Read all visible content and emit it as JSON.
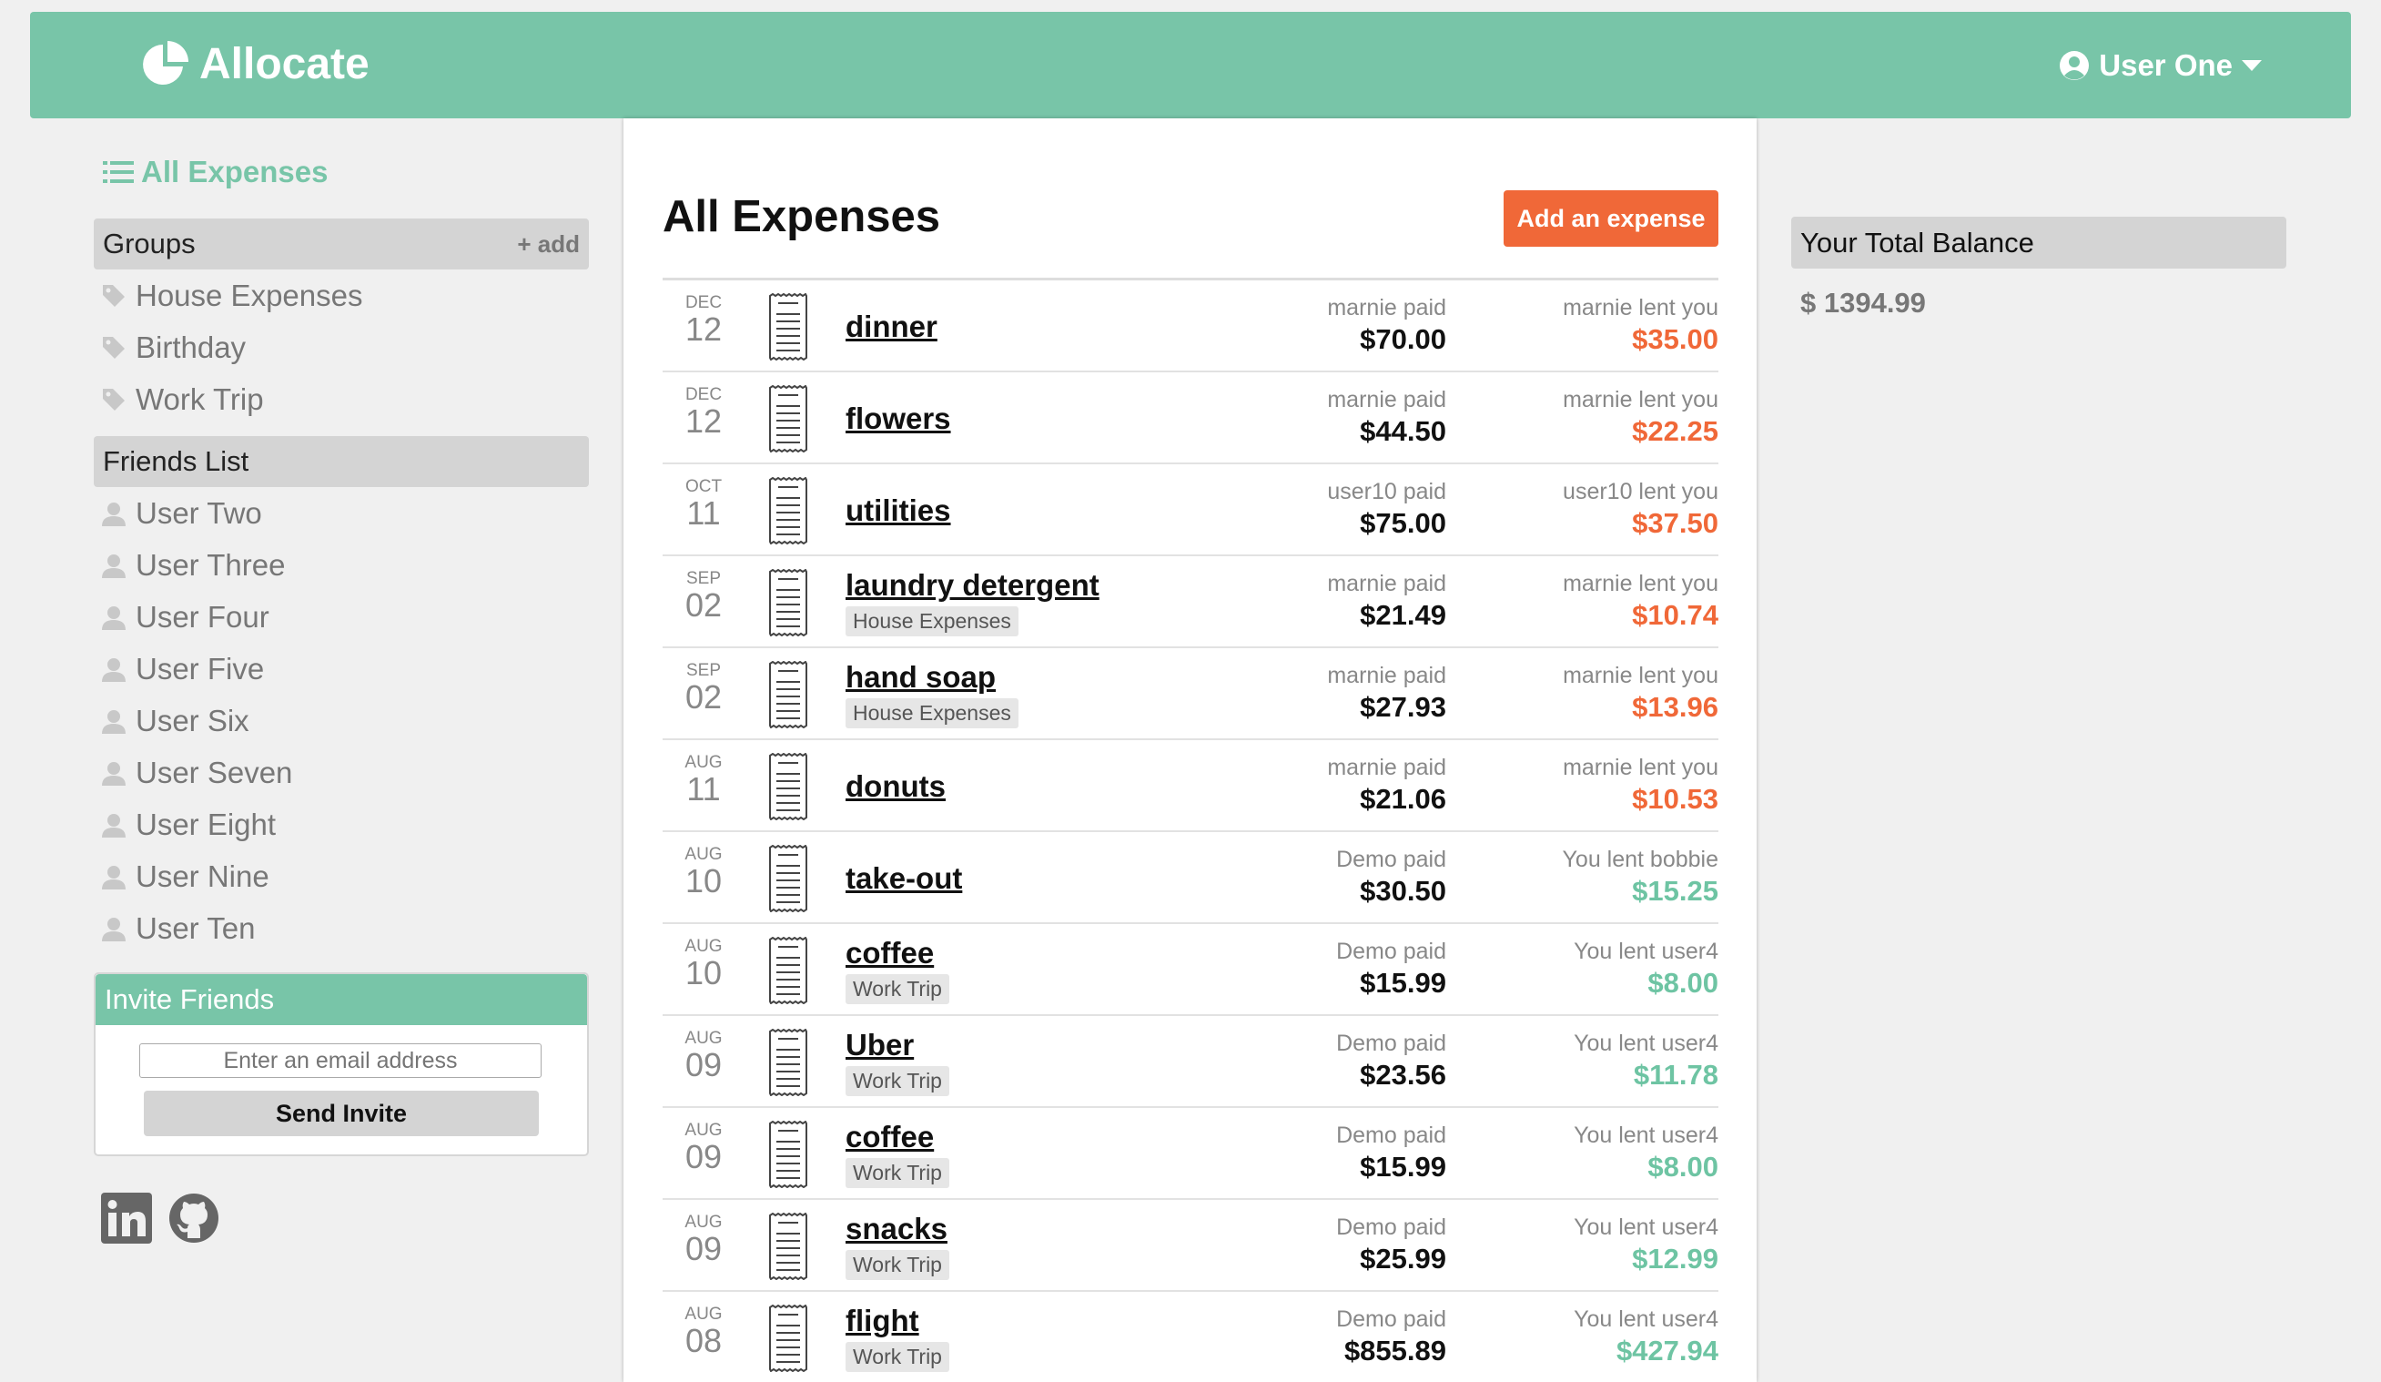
{
  "header": {
    "brand": "Allocate",
    "user": "User One"
  },
  "sidebar": {
    "all_expenses": "All Expenses",
    "groups_title": "Groups",
    "groups_add": "+ add",
    "groups": [
      {
        "label": "House Expenses"
      },
      {
        "label": "Birthday"
      },
      {
        "label": "Work Trip"
      }
    ],
    "friends_title": "Friends List",
    "friends": [
      {
        "label": "User Two"
      },
      {
        "label": "User Three"
      },
      {
        "label": "User Four"
      },
      {
        "label": "User Five"
      },
      {
        "label": "User Six"
      },
      {
        "label": "User Seven"
      },
      {
        "label": "User Eight"
      },
      {
        "label": "User Nine"
      },
      {
        "label": "User Ten"
      }
    ],
    "invite_title": "Invite Friends",
    "invite_placeholder": "Enter an email address",
    "invite_button": "Send Invite",
    "social_icons": [
      "linkedin-icon",
      "github-icon"
    ]
  },
  "main": {
    "title": "All Expenses",
    "add_button": "Add an expense",
    "rows": [
      {
        "mon": "DEC",
        "day": "12",
        "name": "dinner",
        "tag": "",
        "paid_by": "marnie paid",
        "paid": "$70.00",
        "lent_text": "marnie lent you",
        "lent": "$35.00",
        "color": "orange"
      },
      {
        "mon": "DEC",
        "day": "12",
        "name": "flowers",
        "tag": "",
        "paid_by": "marnie paid",
        "paid": "$44.50",
        "lent_text": "marnie lent you",
        "lent": "$22.25",
        "color": "orange"
      },
      {
        "mon": "OCT",
        "day": "11",
        "name": "utilities",
        "tag": "",
        "paid_by": "user10 paid",
        "paid": "$75.00",
        "lent_text": "user10 lent you",
        "lent": "$37.50",
        "color": "orange"
      },
      {
        "mon": "SEP",
        "day": "02",
        "name": "laundry detergent",
        "tag": "House Expenses",
        "paid_by": "marnie paid",
        "paid": "$21.49",
        "lent_text": "marnie lent you",
        "lent": "$10.74",
        "color": "orange"
      },
      {
        "mon": "SEP",
        "day": "02",
        "name": "hand soap",
        "tag": "House Expenses",
        "paid_by": "marnie paid",
        "paid": "$27.93",
        "lent_text": "marnie lent you",
        "lent": "$13.96",
        "color": "orange"
      },
      {
        "mon": "AUG",
        "day": "11",
        "name": "donuts",
        "tag": "",
        "paid_by": "marnie paid",
        "paid": "$21.06",
        "lent_text": "marnie lent you",
        "lent": "$10.53",
        "color": "orange"
      },
      {
        "mon": "AUG",
        "day": "10",
        "name": "take-out",
        "tag": "",
        "paid_by": "Demo paid",
        "paid": "$30.50",
        "lent_text": "You lent bobbie",
        "lent": "$15.25",
        "color": "green"
      },
      {
        "mon": "AUG",
        "day": "10",
        "name": "coffee",
        "tag": "Work Trip",
        "paid_by": "Demo paid",
        "paid": "$15.99",
        "lent_text": "You lent user4",
        "lent": "$8.00",
        "color": "green"
      },
      {
        "mon": "AUG",
        "day": "09",
        "name": "Uber",
        "tag": "Work Trip",
        "paid_by": "Demo paid",
        "paid": "$23.56",
        "lent_text": "You lent user4",
        "lent": "$11.78",
        "color": "green"
      },
      {
        "mon": "AUG",
        "day": "09",
        "name": "coffee",
        "tag": "Work Trip",
        "paid_by": "Demo paid",
        "paid": "$15.99",
        "lent_text": "You lent user4",
        "lent": "$8.00",
        "color": "green"
      },
      {
        "mon": "AUG",
        "day": "09",
        "name": "snacks",
        "tag": "Work Trip",
        "paid_by": "Demo paid",
        "paid": "$25.99",
        "lent_text": "You lent user4",
        "lent": "$12.99",
        "color": "green"
      },
      {
        "mon": "AUG",
        "day": "08",
        "name": "flight",
        "tag": "Work Trip",
        "paid_by": "Demo paid",
        "paid": "$855.89",
        "lent_text": "You lent user4",
        "lent": "$427.94",
        "color": "green"
      }
    ]
  },
  "balance": {
    "title": "Your Total Balance",
    "value": "$ 1394.99"
  },
  "colors": {
    "brand": "#78c5a8",
    "owe": "#f06838",
    "lent": "#6ec4a3"
  }
}
